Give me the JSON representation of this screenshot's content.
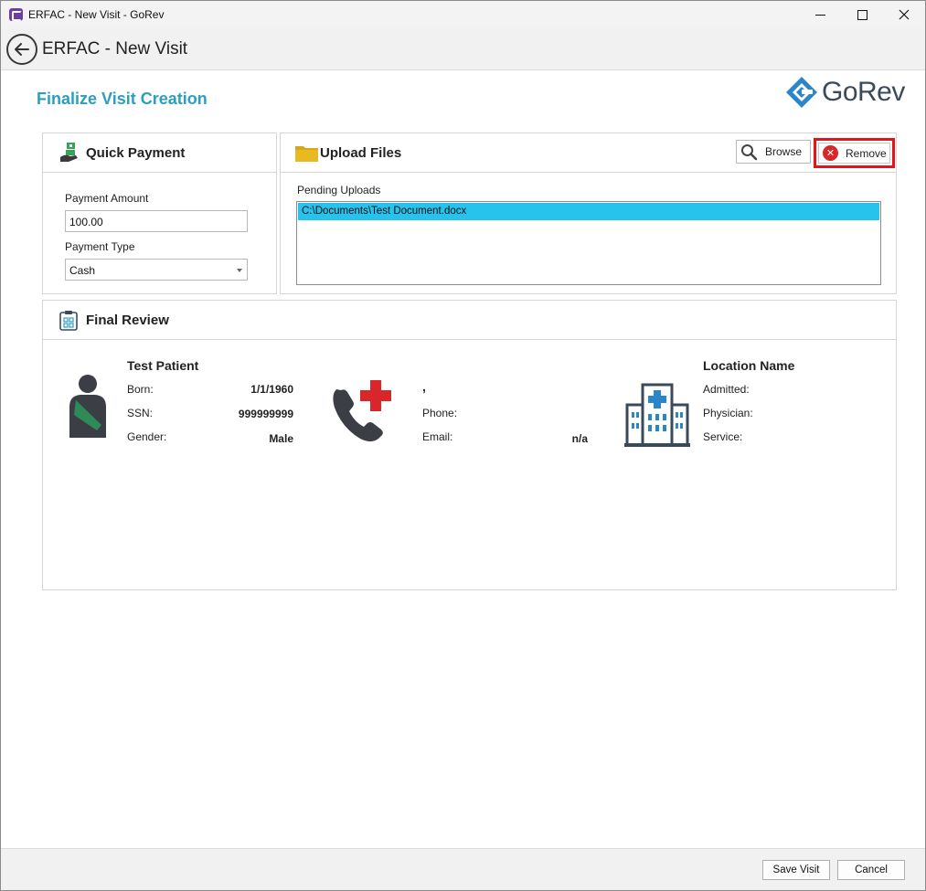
{
  "window": {
    "title": "ERFAC - New Visit - GoRev"
  },
  "header": {
    "title": "ERFAC - New Visit"
  },
  "page": {
    "title": "Finalize Visit Creation"
  },
  "logo": {
    "text": "GoRev"
  },
  "quick_payment": {
    "title": "Quick Payment",
    "amount_label": "Payment Amount",
    "amount_value": "100.00",
    "type_label": "Payment Type",
    "type_value": "Cash"
  },
  "upload_files": {
    "title": "Upload Files",
    "browse_label": "Browse",
    "remove_label": "Remove",
    "pending_label": "Pending Uploads",
    "files": [
      "C:\\Documents\\Test Document.docx"
    ]
  },
  "final_review": {
    "title": "Final Review",
    "patient": {
      "name": "Test Patient",
      "born_label": "Born:",
      "born_value": "1/1/1960",
      "ssn_label": "SSN:",
      "ssn_value": "999999999",
      "gender_label": "Gender:",
      "gender_value": "Male"
    },
    "contact": {
      "name": ",",
      "phone_label": "Phone:",
      "phone_value": "",
      "email_label": "Email:",
      "email_value": "n/a"
    },
    "location": {
      "name": "Location Name",
      "admitted_label": "Admitted:",
      "physician_label": "Physician:",
      "service_label": "Service:"
    }
  },
  "footer": {
    "save_label": "Save Visit",
    "cancel_label": "Cancel"
  },
  "colors": {
    "accent": "#2a9fc0",
    "highlight": "#27c3ed",
    "remove_outline": "#e3141c",
    "medical_red": "#d9262b",
    "patient_green": "#2e8b57"
  }
}
